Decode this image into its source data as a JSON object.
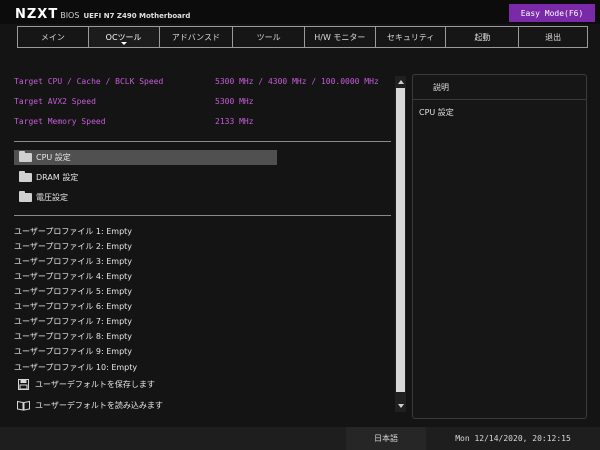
{
  "header": {
    "logo": "NZXT",
    "bios_label": "BIOS",
    "model": "UEFI N7 Z490 Motherboard",
    "easy_mode_button": "Easy Mode(F6)"
  },
  "tabs": [
    {
      "label": "メイン"
    },
    {
      "label": "OCツール"
    },
    {
      "label": "アドバンスド"
    },
    {
      "label": "ツール"
    },
    {
      "label": "H/W モニター"
    },
    {
      "label": "セキュリティ"
    },
    {
      "label": "起動"
    },
    {
      "label": "退出"
    }
  ],
  "active_tab": "OCツール",
  "info": [
    {
      "label": "Target CPU / Cache / BCLK Speed",
      "value": "5300 MHz / 4300 MHz / 100.0000 MHz"
    },
    {
      "label": "Target AVX2 Speed",
      "value": "5300 MHz"
    },
    {
      "label": "Target Memory Speed",
      "value": "2133 MHz"
    }
  ],
  "menu_items": [
    {
      "label": "CPU 設定",
      "icon": "folder-icon"
    },
    {
      "label": "DRAM 設定",
      "icon": "folder-icon"
    },
    {
      "label": "電圧設定",
      "icon": "folder-icon"
    }
  ],
  "profiles": [
    "ユーザープロファイル 1: Empty",
    "ユーザープロファイル 2: Empty",
    "ユーザープロファイル 3: Empty",
    "ユーザープロファイル 4: Empty",
    "ユーザープロファイル 5: Empty",
    "ユーザープロファイル 6: Empty",
    "ユーザープロファイル 7: Empty",
    "ユーザープロファイル 8: Empty",
    "ユーザープロファイル 9: Empty",
    "ユーザープロファイル 10: Empty"
  ],
  "actions": [
    {
      "label": "ユーザーデフォルトを保存します",
      "icon": "floppy-disk-icon"
    },
    {
      "label": "ユーザーデフォルトを読み込みます",
      "icon": "open-book-icon"
    }
  ],
  "description": {
    "title": "説明",
    "body": "CPU 設定"
  },
  "footer": {
    "language": "日本語",
    "datetime": "Mon 12/14/2020, 20:12:15"
  },
  "colors": {
    "accent": "#c55dd8",
    "easy_mode_bg": "#7a2aa8",
    "selected_bg": "#505050"
  }
}
